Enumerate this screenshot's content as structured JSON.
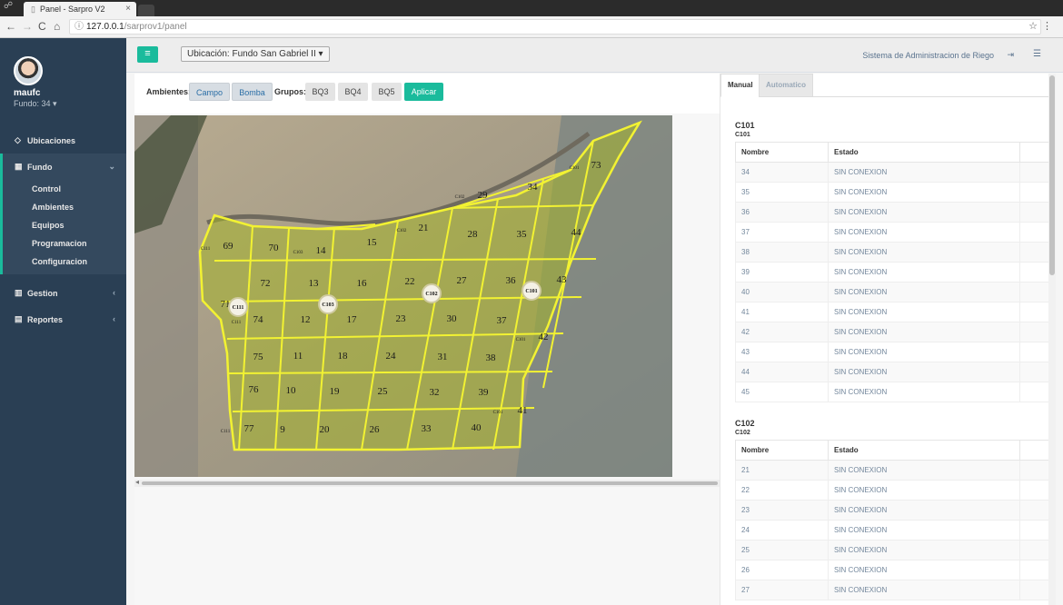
{
  "browser": {
    "tab_title": "Panel - Sarpro V2",
    "url_host": "127.0.0.1",
    "url_path": "/sarprov1/panel"
  },
  "sidebar": {
    "user": "maufc",
    "fundo": "Fundo: 34",
    "items": [
      {
        "label": "Ubicaciones",
        "icon": "diamond-icon"
      },
      {
        "label": "Fundo",
        "icon": "grid-icon"
      },
      {
        "label": "Gestion",
        "icon": "bar-chart-icon"
      },
      {
        "label": "Reportes",
        "icon": "file-icon"
      }
    ],
    "fundo_sub": [
      "Control",
      "Ambientes",
      "Equipos",
      "Programacion",
      "Configuracion"
    ]
  },
  "topnav": {
    "ubicacion": "Ubicación: Fundo San Gabriel II",
    "system_name": "Sistema de Administracion de Riego"
  },
  "controls": {
    "ambientes_label": "Ambientes:",
    "campo": "Campo",
    "bomba": "Bomba",
    "grupos_label": "Grupos:",
    "bq3": "BQ3",
    "bq4": "BQ4",
    "bq5": "BQ5",
    "aplicar": "Aplicar"
  },
  "map": {
    "plots": [
      "73",
      "29",
      "34",
      "21",
      "28",
      "35",
      "44",
      "69",
      "70",
      "14",
      "15",
      "72",
      "13",
      "16",
      "22",
      "27",
      "36",
      "43",
      "71",
      "74",
      "12",
      "17",
      "23",
      "30",
      "37",
      "42",
      "75",
      "11",
      "18",
      "24",
      "31",
      "38",
      "76",
      "10",
      "19",
      "25",
      "32",
      "39",
      "41",
      "77",
      "9",
      "20",
      "26",
      "33",
      "40"
    ],
    "controllers": [
      "C101",
      "C102",
      "C103",
      "C111"
    ],
    "sector_labels": [
      "C101",
      "C102",
      "C103",
      "C111"
    ]
  },
  "right": {
    "tab_manual": "Manual",
    "tab_auto": "Automatico",
    "col_nombre": "Nombre",
    "col_estado": "Estado",
    "c101": {
      "title": "C101",
      "subtitle": "C101",
      "rows": [
        {
          "nombre": "34",
          "estado": "SIN CONEXION"
        },
        {
          "nombre": "35",
          "estado": "SIN CONEXION"
        },
        {
          "nombre": "36",
          "estado": "SIN CONEXION"
        },
        {
          "nombre": "37",
          "estado": "SIN CONEXION"
        },
        {
          "nombre": "38",
          "estado": "SIN CONEXION"
        },
        {
          "nombre": "39",
          "estado": "SIN CONEXION"
        },
        {
          "nombre": "40",
          "estado": "SIN CONEXION"
        },
        {
          "nombre": "41",
          "estado": "SIN CONEXION"
        },
        {
          "nombre": "42",
          "estado": "SIN CONEXION"
        },
        {
          "nombre": "43",
          "estado": "SIN CONEXION"
        },
        {
          "nombre": "44",
          "estado": "SIN CONEXION"
        },
        {
          "nombre": "45",
          "estado": "SIN CONEXION"
        }
      ]
    },
    "c102": {
      "title": "C102",
      "subtitle": "C102",
      "rows": [
        {
          "nombre": "21",
          "estado": "SIN CONEXION"
        },
        {
          "nombre": "22",
          "estado": "SIN CONEXION"
        },
        {
          "nombre": "23",
          "estado": "SIN CONEXION"
        },
        {
          "nombre": "24",
          "estado": "SIN CONEXION"
        },
        {
          "nombre": "25",
          "estado": "SIN CONEXION"
        },
        {
          "nombre": "26",
          "estado": "SIN CONEXION"
        },
        {
          "nombre": "27",
          "estado": "SIN CONEXION"
        }
      ]
    }
  }
}
